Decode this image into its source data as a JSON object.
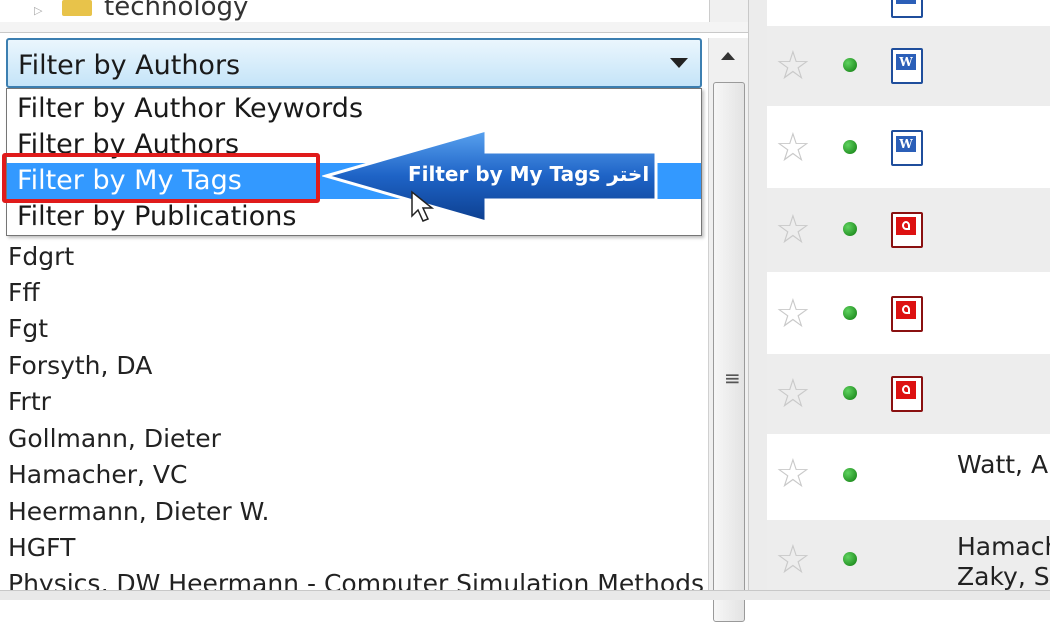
{
  "tree": {
    "folder_label": "technology"
  },
  "filter_combo": {
    "selected": "Filter by Authors"
  },
  "dropdown": {
    "options": [
      "Filter by Author Keywords",
      "Filter by Authors",
      "Filter by My Tags",
      "Filter by Publications"
    ],
    "highlighted_index": 2
  },
  "author_list": [
    "Fdgrt",
    "Fff",
    "Fgt",
    "Forsyth, DA",
    "Frtr",
    "Gollmann, Dieter",
    "Hamacher, VC",
    "Heermann, Dieter W.",
    "HGFT",
    "Physics, DW Heermann - Computer Simulation Methods i"
  ],
  "callout": {
    "text": "Filter by My Tags اختر",
    "color": "#1e63c6"
  },
  "documents": [
    {
      "type": "word",
      "author": ""
    },
    {
      "type": "word",
      "author": ""
    },
    {
      "type": "pdf",
      "author": ""
    },
    {
      "type": "pdf",
      "author": ""
    },
    {
      "type": "pdf",
      "author": ""
    },
    {
      "type": "none",
      "author": "Watt, A"
    },
    {
      "type": "none",
      "author": "Hamach",
      "author2": "Zaky, S("
    }
  ]
}
